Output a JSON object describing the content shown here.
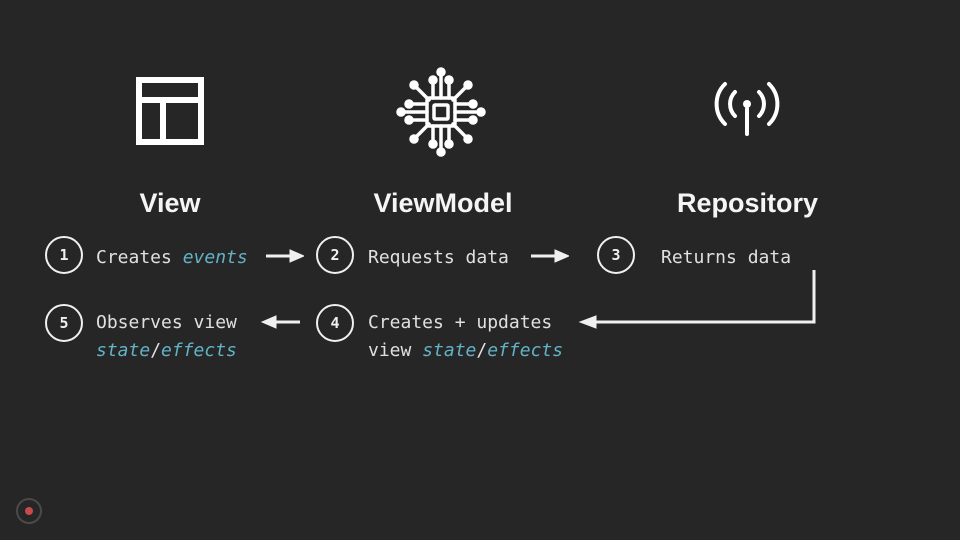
{
  "columns": {
    "view": {
      "title": "View"
    },
    "viewmodel": {
      "title": "ViewModel"
    },
    "repository": {
      "title": "Repository"
    }
  },
  "steps": {
    "s1": {
      "num": "1",
      "pre": "Creates ",
      "hi1": "events"
    },
    "s2": {
      "num": "2",
      "text": "Requests data"
    },
    "s3": {
      "num": "3",
      "text": "Returns data"
    },
    "s4": {
      "num": "4",
      "line1": "Creates + updates",
      "line2pre": "view ",
      "hi1": "state",
      "slash": "/",
      "hi2": "effects"
    },
    "s5": {
      "num": "5",
      "line1": "Observes view",
      "hi1": "state",
      "slash": "/",
      "hi2": "effects"
    }
  }
}
